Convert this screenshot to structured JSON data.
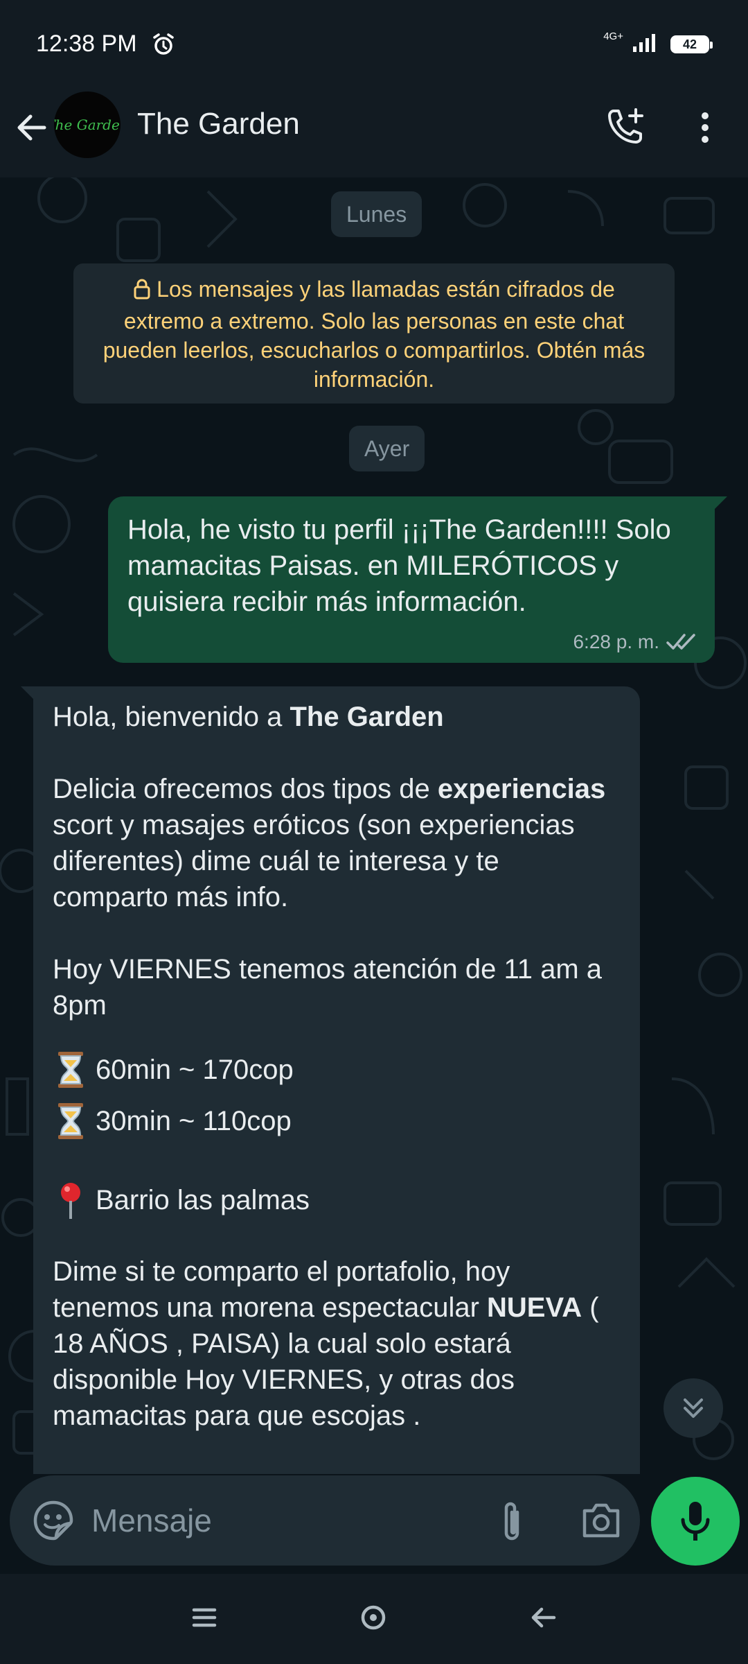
{
  "status_bar": {
    "time": "12:38 PM",
    "network": "4G+",
    "battery": "42"
  },
  "header": {
    "contact_name": "The Garden",
    "avatar_text": "The Garden"
  },
  "chat": {
    "date_monday": "Lunes",
    "encryption_notice": "Los mensajes y las llamadas están cifrados de extremo a extremo. Solo las personas en este chat pueden leerlos, escucharlos o compartirlos. Obtén más información.",
    "date_yesterday": "Ayer",
    "outgoing": {
      "text": "Hola, he visto tu perfil ¡¡¡The Garden!!!! Solo mamacitas Paisas. en MILERÓTICOS y quisiera recibir más información.",
      "time": "6:28 p. m."
    },
    "incoming": {
      "greeting": "Hola, bienvenido a ",
      "greeting_bold": "The Garden",
      "p1_a": "Delicia ofrecemos dos tipos de ",
      "p1_bold": "experiencias",
      "p1_b": " scort y masajes eróticos (son experiencias diferentes) dime cuál te interesa y te comparto más info.",
      "p2": "Hoy VIERNES  tenemos atención de 11 am a 8pm",
      "rate1": "60min ~ 170cop",
      "rate2": "30min ~ 110cop",
      "location": "Barrio las palmas",
      "p3_a": "Dime si te comparto el portafolio, hoy tenemos una morena espectacular ",
      "p3_bold": "NUEVA",
      "p3_b": " ( 18 AÑOS , PAISA) la cual solo estará disponible Hoy  VIERNES, y otras dos mamacitas para que escojas ."
    }
  },
  "input": {
    "placeholder": "Mensaje"
  },
  "colors": {
    "accent": "#21c063",
    "outgoing_bubble": "#144d37",
    "incoming_bubble": "#1f2c34",
    "encryption_text": "#ffd279"
  }
}
